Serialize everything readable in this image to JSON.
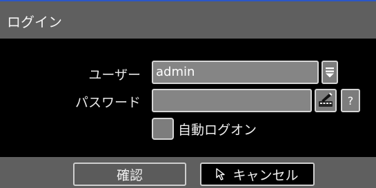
{
  "dialog": {
    "title": "ログイン"
  },
  "form": {
    "user_label": "ユーザー",
    "user_value": "admin",
    "password_label": "パスワード",
    "password_value": "",
    "help_label": "?",
    "auto_logon_label": "自動ログオン",
    "auto_logon_checked": false
  },
  "footer": {
    "confirm_label": "確認",
    "cancel_label": "キャンセル"
  },
  "icons": {
    "dropdown": "dropdown-arrow-icon",
    "keyboard": "virtual-keyboard-icon",
    "cursor": "pointer-cursor-icon"
  },
  "colors": {
    "accent": "#2b56c8",
    "panel": "#5f5f5f",
    "field": "#858585"
  }
}
